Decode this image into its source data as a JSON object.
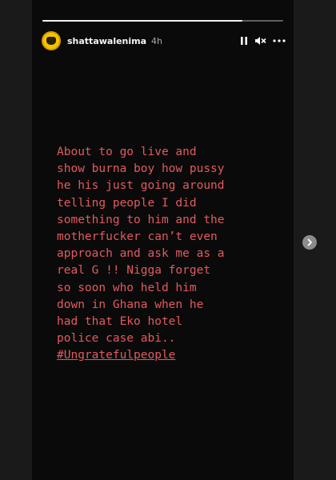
{
  "story": {
    "username": "shattawalenima",
    "time": "4h",
    "progress": 0.83,
    "caption_lines": [
      "About to go live and",
      "show burna boy how pussy",
      "he his just going around",
      "telling people I did",
      "something to him and the",
      "motherfucker can’t even",
      "approach and ask me as a",
      "real G !! Nigga forget",
      "so soon who held him",
      "down in Ghana when he",
      "had that Eko hotel",
      "police case abi.."
    ],
    "hashtag": "#Ungratefulpeople"
  },
  "colors": {
    "caption": "#e35a5f",
    "background": "#0a0a0a",
    "avatar": "#f5c400"
  },
  "icons": {
    "pause": "pause-icon",
    "mute": "muted-speaker-icon",
    "more": "more-options-icon",
    "next": "chevron-right-icon"
  }
}
